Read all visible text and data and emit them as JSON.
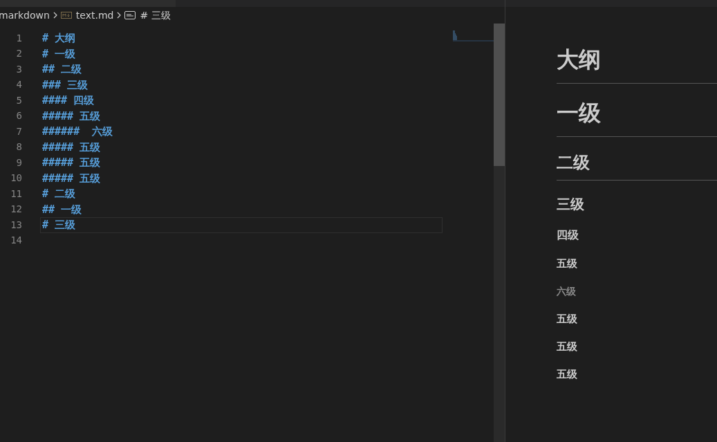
{
  "breadcrumb": [
    {
      "kind": "folder",
      "label": "markdown"
    },
    {
      "kind": "file",
      "label": "text.md"
    },
    {
      "kind": "symbol",
      "label": "# 三级"
    }
  ],
  "editor": {
    "lines": [
      {
        "number": "1",
        "text": "# 大纲",
        "current": false
      },
      {
        "number": "2",
        "text": "# 一级",
        "current": false
      },
      {
        "number": "3",
        "text": "## 二级",
        "current": false
      },
      {
        "number": "4",
        "text": "### 三级",
        "current": false
      },
      {
        "number": "5",
        "text": "#### 四级",
        "current": false
      },
      {
        "number": "6",
        "text": "##### 五级",
        "current": false
      },
      {
        "number": "7",
        "text": "######  六级",
        "current": false
      },
      {
        "number": "8",
        "text": "##### 五级",
        "current": false
      },
      {
        "number": "9",
        "text": "##### 五级",
        "current": false
      },
      {
        "number": "10",
        "text": "##### 五级",
        "current": false
      },
      {
        "number": "11",
        "text": "# 二级",
        "current": false
      },
      {
        "number": "12",
        "text": "## 一级",
        "current": false
      },
      {
        "number": "13",
        "text": "# 三级",
        "current": true
      },
      {
        "number": "14",
        "current": false
      }
    ]
  },
  "preview": {
    "headings": [
      {
        "kind": "h1",
        "text": "大纲"
      },
      {
        "kind": "h1",
        "text": "一级"
      },
      {
        "kind": "h2",
        "text": "二级"
      },
      {
        "kind": "h3",
        "text": "三级"
      },
      {
        "kind": "h4",
        "text": "四级"
      },
      {
        "kind": "h5",
        "text": "五级"
      },
      {
        "kind": "h6",
        "text": "六级"
      },
      {
        "kind": "h5",
        "text": "五级"
      },
      {
        "kind": "h5",
        "text": "五级"
      },
      {
        "kind": "h5",
        "text": "五级"
      }
    ]
  }
}
